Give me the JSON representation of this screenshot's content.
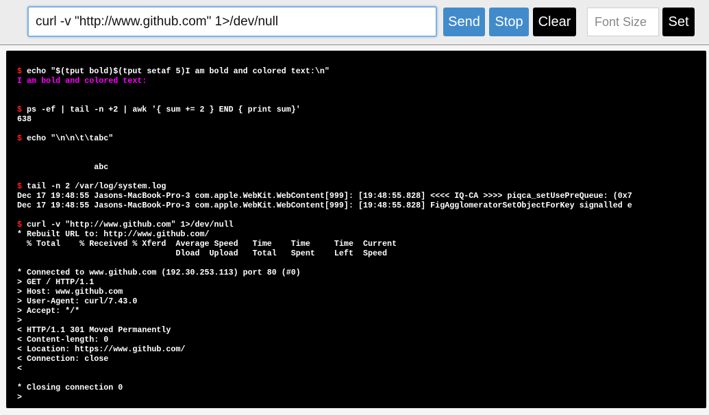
{
  "toolbar": {
    "command_value": "curl -v \"http://www.github.com\" 1>/dev/null",
    "send_label": "Send",
    "stop_label": "Stop",
    "clear_label": "Clear",
    "font_size_placeholder": "Font Size",
    "font_size_value": "",
    "set_label": "Set"
  },
  "colors": {
    "prompt": "#ff2020",
    "colored_output": "#ff00ff",
    "primary_button": "#428bca",
    "dark_button": "#000000",
    "terminal_bg": "#000000"
  },
  "terminal": {
    "prompt_symbol": "$",
    "lines": [
      {
        "type": "command",
        "text": "echo \"$(tput bold)$(tput setaf 5)I am bold and colored text:\\n\""
      },
      {
        "type": "colored",
        "text": "I am bold and colored text:"
      },
      {
        "type": "output",
        "text": ""
      },
      {
        "type": "output",
        "text": ""
      },
      {
        "type": "command",
        "text": "ps -ef | tail -n +2 | awk '{ sum += 2 } END { print sum}'"
      },
      {
        "type": "output",
        "text": "638"
      },
      {
        "type": "output",
        "text": ""
      },
      {
        "type": "command",
        "text": "echo \"\\n\\n\\t\\tabc\""
      },
      {
        "type": "output",
        "text": ""
      },
      {
        "type": "output",
        "text": ""
      },
      {
        "type": "output",
        "text": "                abc"
      },
      {
        "type": "output",
        "text": ""
      },
      {
        "type": "command",
        "text": "tail -n 2 /var/log/system.log"
      },
      {
        "type": "output",
        "text": "Dec 17 19:48:55 Jasons-MacBook-Pro-3 com.apple.WebKit.WebContent[999]: [19:48:55.828] <<<< IQ-CA >>>> piqca_setUsePreQueue: (0x7"
      },
      {
        "type": "output",
        "text": "Dec 17 19:48:55 Jasons-MacBook-Pro-3 com.apple.WebKit.WebContent[999]: [19:48:55.828] FigAgglomeratorSetObjectForKey signalled e"
      },
      {
        "type": "output",
        "text": ""
      },
      {
        "type": "command",
        "text": "curl -v \"http://www.github.com\" 1>/dev/null"
      },
      {
        "type": "output",
        "text": "* Rebuilt URL to: http://www.github.com/"
      },
      {
        "type": "output",
        "text": "  % Total    % Received % Xferd  Average Speed   Time    Time     Time  Current"
      },
      {
        "type": "output",
        "text": "                                 Dload  Upload   Total   Spent    Left  Speed"
      },
      {
        "type": "output",
        "text": ""
      },
      {
        "type": "output",
        "text": "* Connected to www.github.com (192.30.253.113) port 80 (#0)"
      },
      {
        "type": "output",
        "text": "> GET / HTTP/1.1"
      },
      {
        "type": "output",
        "text": "> Host: www.github.com"
      },
      {
        "type": "output",
        "text": "> User-Agent: curl/7.43.0"
      },
      {
        "type": "output",
        "text": "> Accept: */*"
      },
      {
        "type": "output",
        "text": ">"
      },
      {
        "type": "output",
        "text": "< HTTP/1.1 301 Moved Permanently"
      },
      {
        "type": "output",
        "text": "< Content-length: 0"
      },
      {
        "type": "output",
        "text": "< Location: https://www.github.com/"
      },
      {
        "type": "output",
        "text": "< Connection: close"
      },
      {
        "type": "output",
        "text": "<"
      },
      {
        "type": "output",
        "text": ""
      },
      {
        "type": "output",
        "text": "* Closing connection 0"
      },
      {
        "type": "output",
        "text": ">"
      }
    ]
  }
}
